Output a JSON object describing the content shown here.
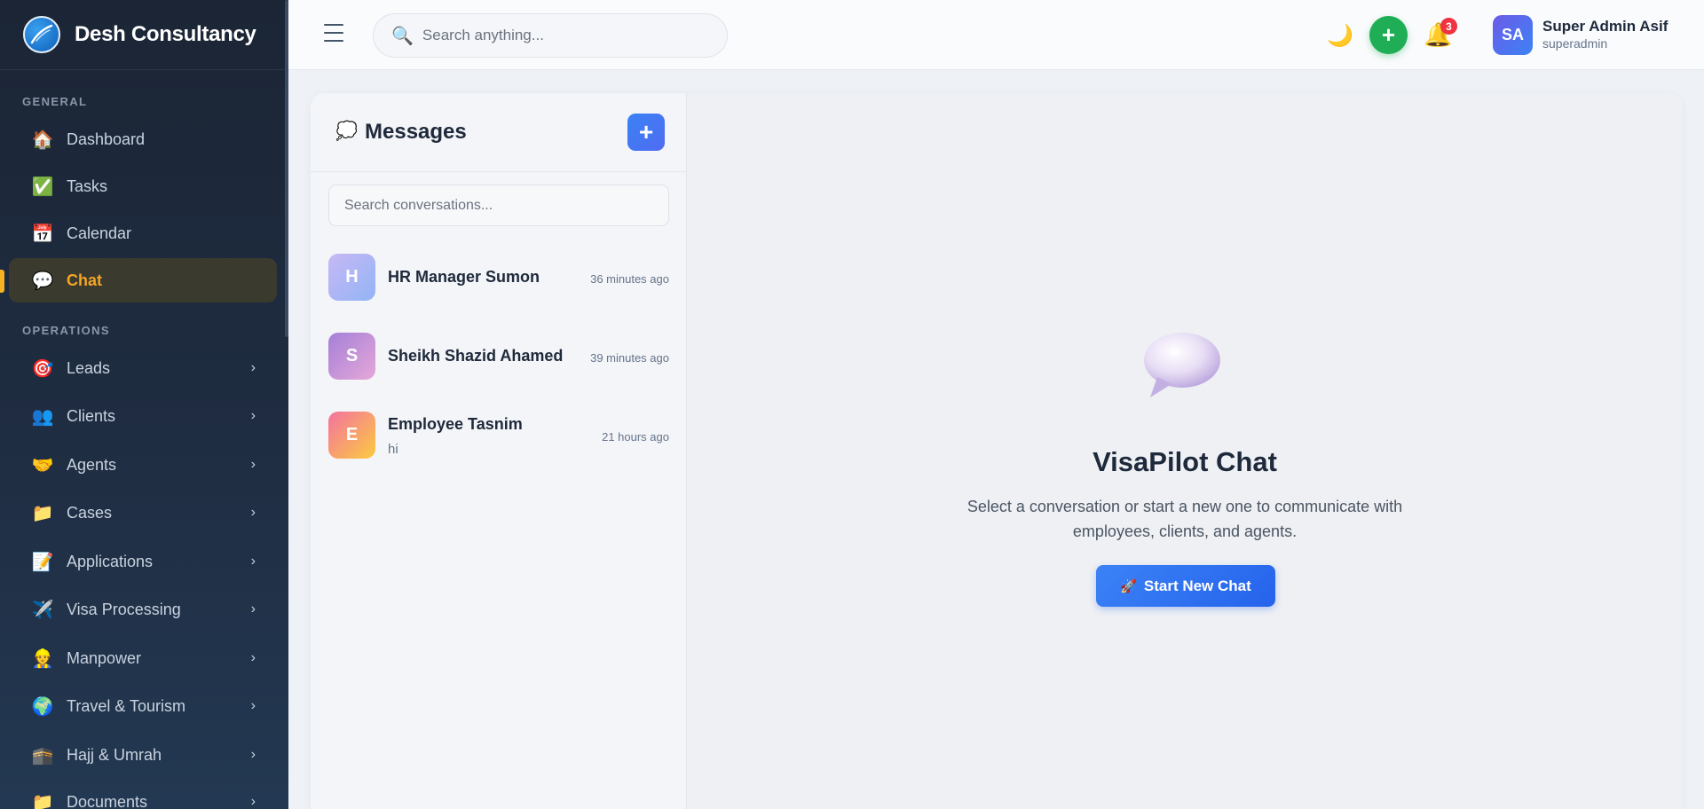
{
  "brand": {
    "name": "Desh Consultancy"
  },
  "sidebar": {
    "sections": [
      {
        "title": "GENERAL"
      },
      {
        "title": "OPERATIONS"
      }
    ],
    "items": [
      {
        "label": "Dashboard",
        "icon": "house-icon"
      },
      {
        "label": "Tasks",
        "icon": "checkbox-icon"
      },
      {
        "label": "Calendar",
        "icon": "calendar-icon"
      },
      {
        "label": "Chat",
        "icon": "speech-bubble-icon",
        "active": true
      },
      {
        "label": "Leads",
        "icon": "target-icon"
      },
      {
        "label": "Clients",
        "icon": "people-icon"
      },
      {
        "label": "Agents",
        "icon": "handshake-icon"
      },
      {
        "label": "Cases",
        "icon": "folder-icon"
      },
      {
        "label": "Applications",
        "icon": "document-icon"
      },
      {
        "label": "Visa Processing",
        "icon": "airplane-icon"
      },
      {
        "label": "Manpower",
        "icon": "worker-icon"
      },
      {
        "label": "Travel & Tourism",
        "icon": "globe-icon"
      },
      {
        "label": "Hajj & Umrah",
        "icon": "kaaba-icon"
      },
      {
        "label": "Documents",
        "icon": "folder-icon"
      }
    ]
  },
  "header": {
    "search_placeholder": "Search anything...",
    "notification_count": "3",
    "user": {
      "initials": "SA",
      "name": "Super Admin Asif",
      "role": "superadmin"
    }
  },
  "messages": {
    "title": "Messages",
    "search_placeholder": "Search conversations...",
    "conversations": [
      {
        "initial": "H",
        "name": "HR Manager Sumon",
        "time": "36 minutes ago",
        "preview": ""
      },
      {
        "initial": "S",
        "name": "Sheikh Shazid Ahamed",
        "time": "39 minutes ago",
        "preview": ""
      },
      {
        "initial": "E",
        "name": "Employee Tasnim",
        "time": "21 hours ago",
        "preview": "hi"
      }
    ]
  },
  "empty_state": {
    "title": "VisaPilot Chat",
    "description": "Select a conversation or start a new one to communicate with employees, clients, and agents.",
    "button_label": "Start New Chat"
  },
  "colors": {
    "accent": "#f5a524",
    "primary": "#3b82f6",
    "success": "#1fae55",
    "danger": "#ef3340",
    "sidebar_bg": "#1b2535"
  }
}
